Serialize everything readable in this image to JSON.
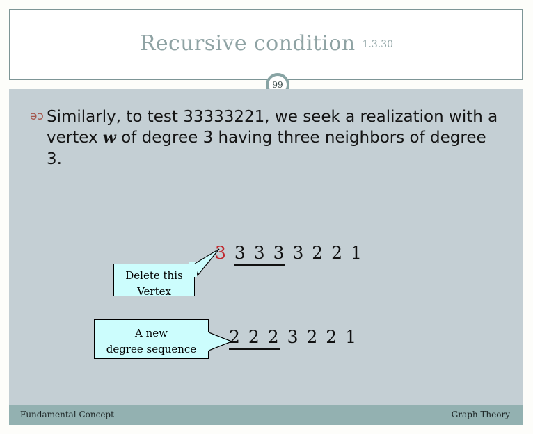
{
  "slide": {
    "title": "Recursive condition",
    "subtitle": "1.3.30",
    "page_number": "99",
    "bullet_glyph": "əɔ",
    "body_text_part1": "Similarly, to test 33333221, we seek a realization with a vertex ",
    "body_var": "w",
    "body_text_part2": " of degree 3 having three neighbors of degree 3."
  },
  "sequences": [
    {
      "name": "original-degree-sequence",
      "lead": "3",
      "marked": "3 3 3",
      "rest": "3 2 2 1"
    },
    {
      "name": "new-degree-sequence",
      "lead": "",
      "marked": "2 2 2",
      "rest": "3 2 2 1"
    }
  ],
  "callouts": {
    "delete_vertex": {
      "line1": "Delete this",
      "line2": "Vertex"
    },
    "new_sequence": {
      "line1": "A new",
      "line2": "degree sequence"
    }
  },
  "footer": {
    "left": "Fundamental Concept",
    "right": "Graph Theory"
  },
  "colors": {
    "body_background": "#c4cfd4",
    "header_background": "#ffffff",
    "title": "#8fa3a4",
    "footer_bar": "#93b1b1",
    "callout_fill": "#ccfdfd",
    "accent_red": "#c0272d",
    "bullet": "#a4584e",
    "rule": "#7d9596"
  }
}
